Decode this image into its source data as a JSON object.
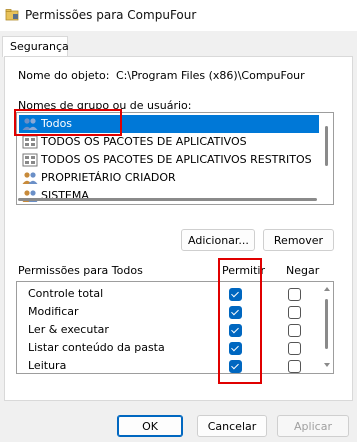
{
  "window": {
    "title": "Permissões para CompuFour"
  },
  "tabs": [
    {
      "label": "Segurança",
      "selected": true
    }
  ],
  "object": {
    "label": "Nome do objeto:",
    "value": "C:\\Program Files (x86)\\CompuFour"
  },
  "groups": {
    "label": "Nomes de grupo ou de usuário:",
    "items": [
      {
        "label": "Todos",
        "icon": "users-icon",
        "selected": true
      },
      {
        "label": "TODOS OS PACOTES DE APLICATIVOS",
        "icon": "package-icon",
        "selected": false
      },
      {
        "label": "TODOS OS PACOTES DE APLICATIVOS RESTRITOS",
        "icon": "package-icon",
        "selected": false
      },
      {
        "label": "PROPRIETÁRIO CRIADOR",
        "icon": "users-icon",
        "selected": false
      },
      {
        "label": "SISTEMA",
        "icon": "users-icon",
        "selected": false
      }
    ]
  },
  "group_buttons": {
    "add": "Adicionar...",
    "remove": "Remover"
  },
  "permissions": {
    "label": "Permissões para Todos",
    "col_allow": "Permitir",
    "col_deny": "Negar",
    "rows": [
      {
        "name": "Controle total",
        "allow": true,
        "deny": false
      },
      {
        "name": "Modificar",
        "allow": true,
        "deny": false
      },
      {
        "name": "Ler & executar",
        "allow": true,
        "deny": false
      },
      {
        "name": "Listar conteúdo da pasta",
        "allow": true,
        "deny": false
      },
      {
        "name": "Leitura",
        "allow": true,
        "deny": false
      }
    ]
  },
  "dialog_buttons": {
    "ok": "OK",
    "cancel": "Cancelar",
    "apply": "Aplicar"
  },
  "colors": {
    "accent": "#0067c0",
    "selection": "#0078d7",
    "highlight": "#e00000"
  }
}
